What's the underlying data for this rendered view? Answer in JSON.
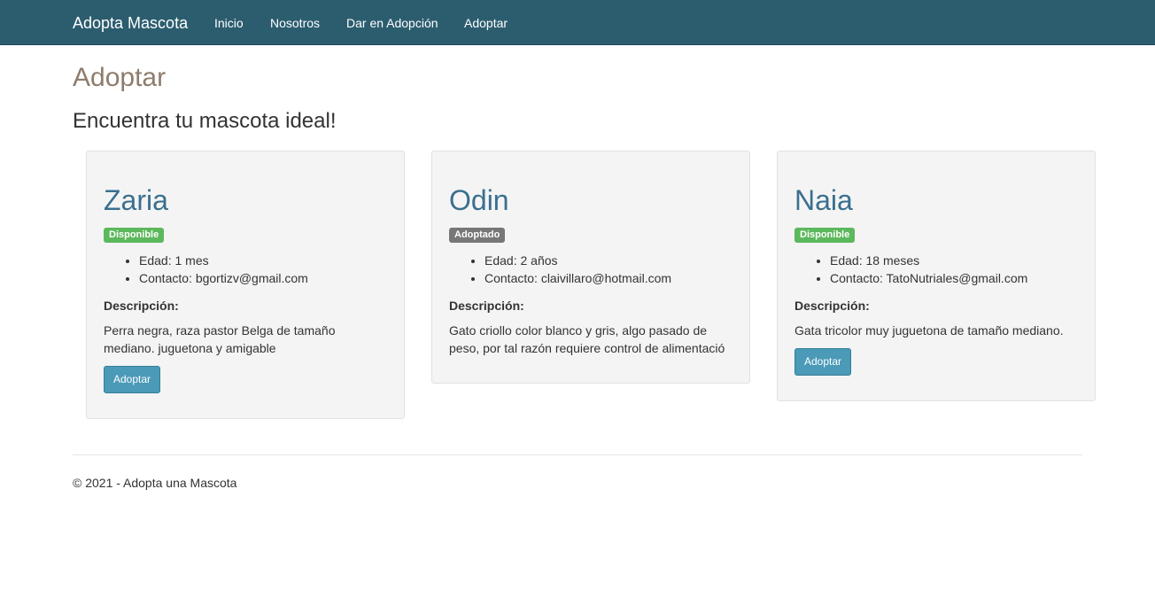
{
  "navbar": {
    "brand": "Adopta Mascota",
    "links": [
      "Inicio",
      "Nosotros",
      "Dar en Adopción",
      "Adoptar"
    ],
    "background": "#2c5d6f"
  },
  "page": {
    "title": "Adoptar",
    "subtitle": "Encuentra tu mascota ideal!"
  },
  "pets": [
    {
      "name": "Zaria",
      "status": "Disponible",
      "status_color": "#5cb85c",
      "details": [
        "Edad: 1 mes",
        "Contacto: bgortizv@gmail.com"
      ],
      "description_label": "Descripción:",
      "description_lines": [
        "Perra negra, raza pastor Belga de tamaño",
        "mediano. juguetona y amigable"
      ],
      "button_label": "Adoptar"
    },
    {
      "name": "Odin",
      "status": "Adoptado",
      "status_color": "#777777",
      "details": [
        "Edad: 2 años",
        "Contacto: claivillaro@hotmail.com"
      ],
      "description_label": "Descripción:",
      "description_lines": [
        "Gato criollo color blanco y gris, algo pasado de",
        "peso, por tal razón requiere control de alimentació"
      ]
    },
    {
      "name": "Naia",
      "status": "Disponible",
      "status_color": "#5cb85c",
      "details": [
        "Edad: 18 meses",
        "Contacto: TatoNutriales@gmail.com"
      ],
      "description_label": "Descripción:",
      "description_lines": [
        "Gata tricolor muy juguetona de tamaño mediano."
      ],
      "button_label": "Adoptar"
    }
  ],
  "footer": {
    "text": "© 2021 - Adopta una Mascota"
  },
  "colors": {
    "accent_button": "#4a9ab8",
    "pet_name": "#3a6f8f",
    "page_title": "#8e7c6c"
  }
}
